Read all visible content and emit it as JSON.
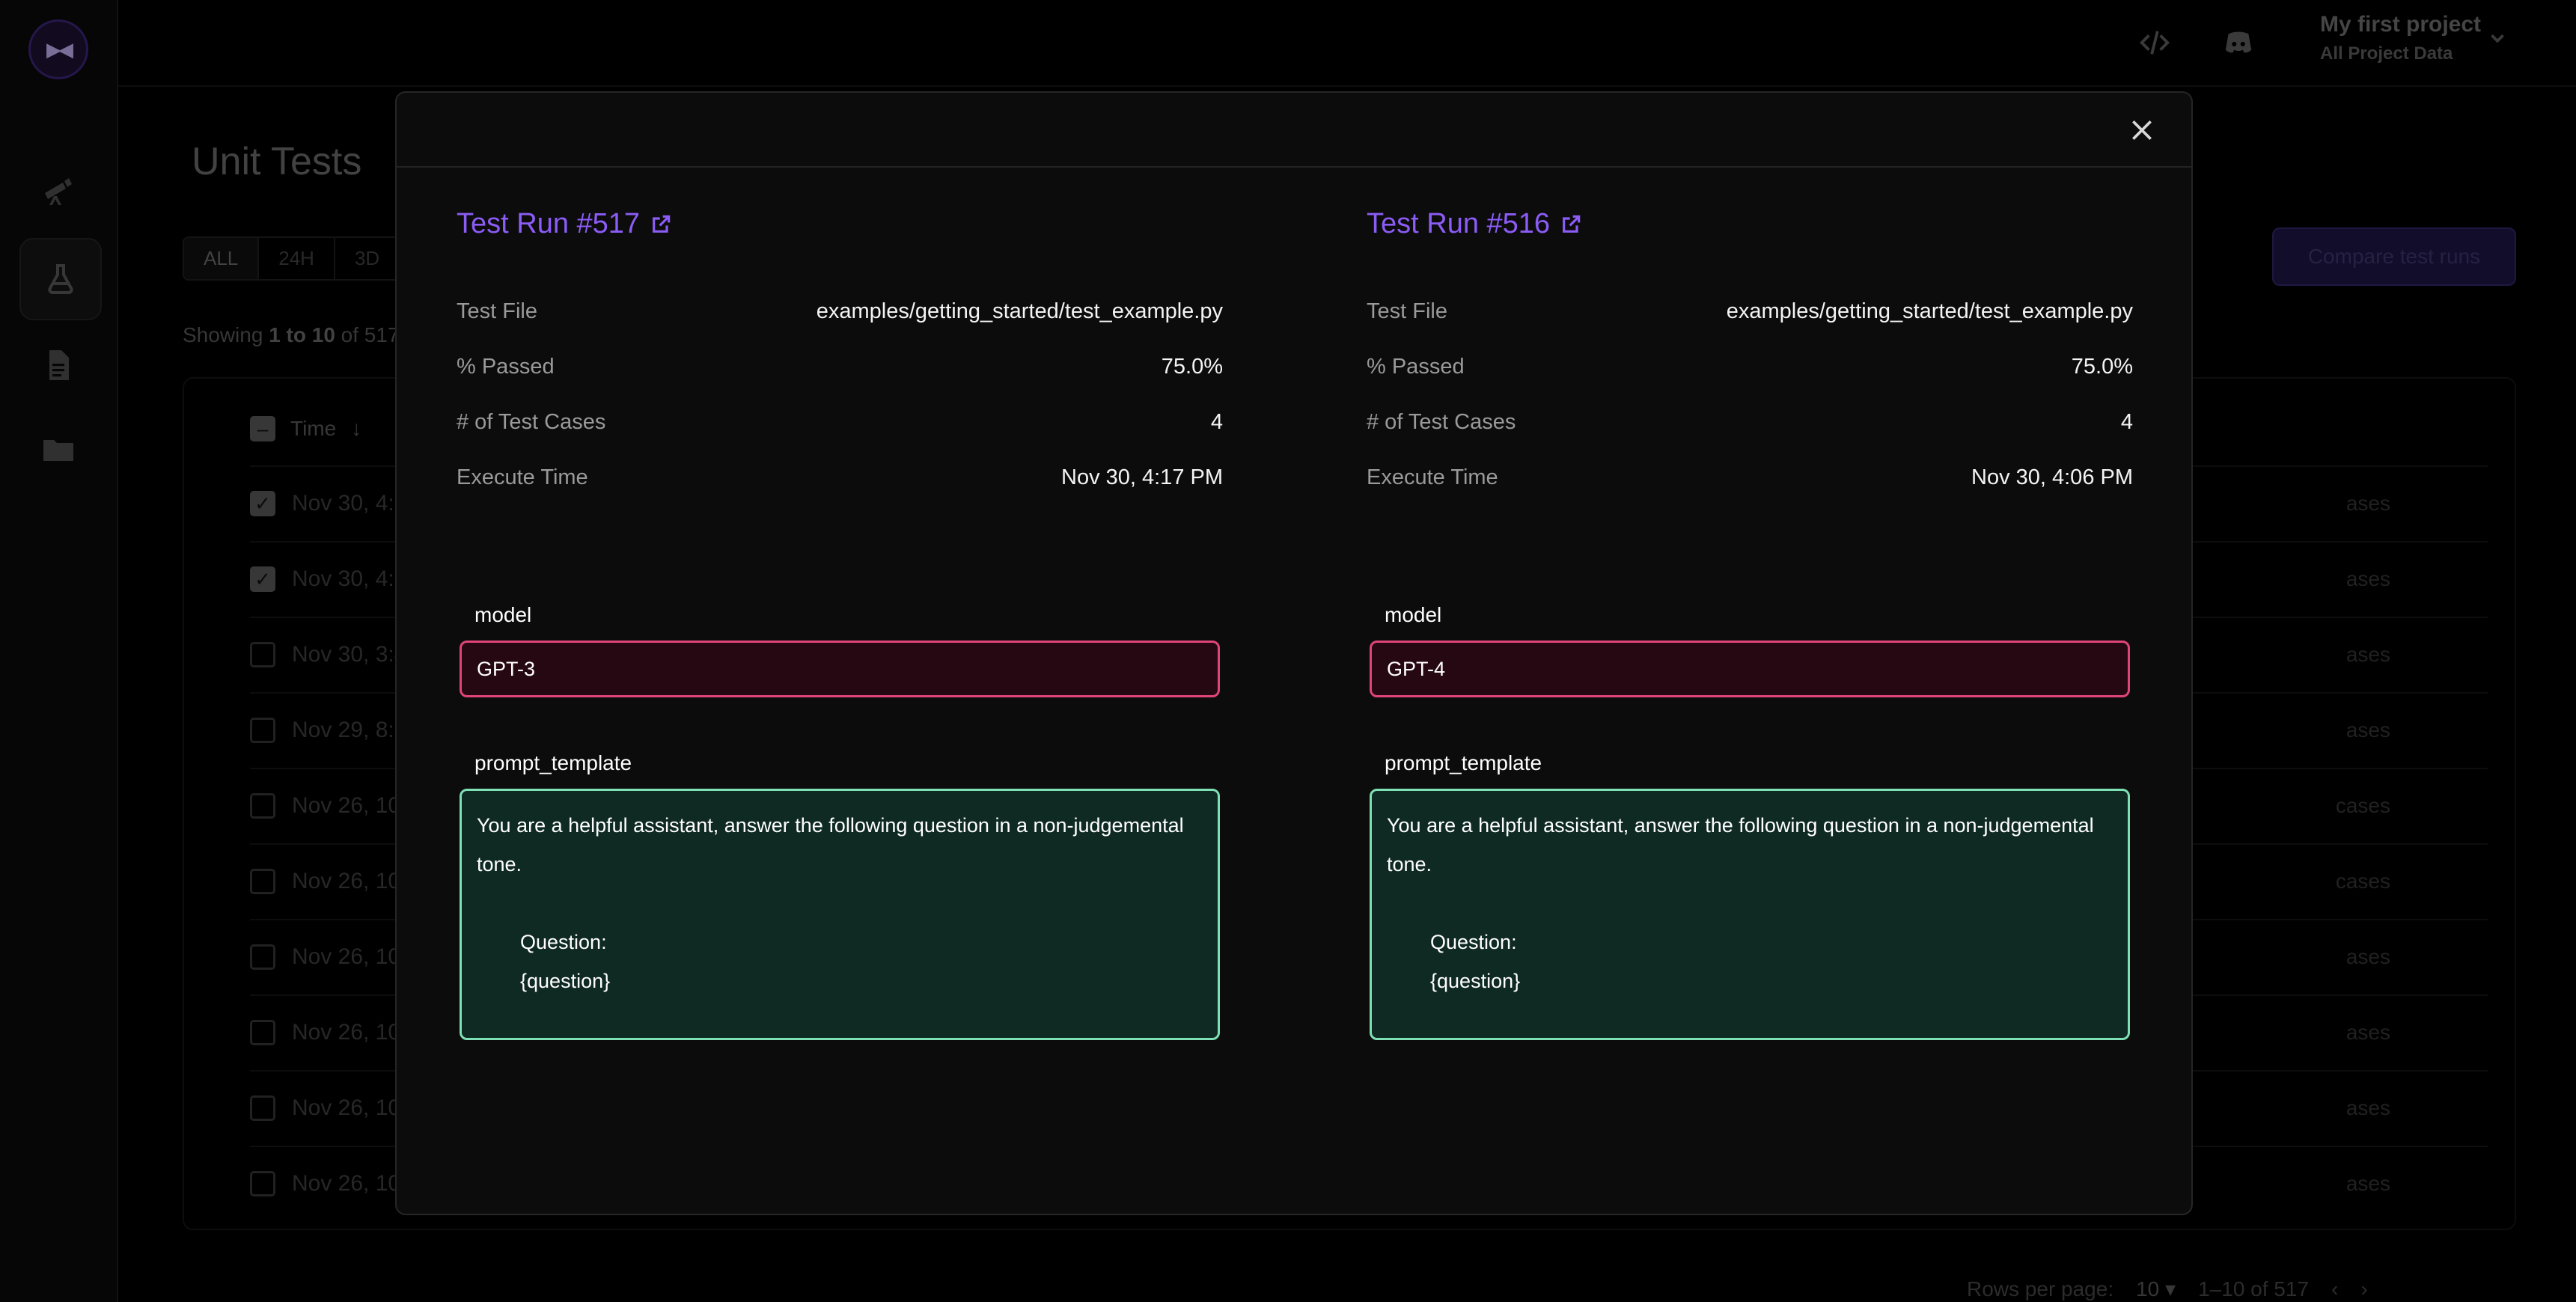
{
  "app": {
    "page_title": "Unit Tests",
    "project_name": "My first project",
    "project_scope": "All Project Data",
    "filters": [
      "ALL",
      "24H",
      "3D"
    ],
    "compare_button": "Compare test runs",
    "showing_prefix": "Showing",
    "showing_range": "1 to 10",
    "showing_suffix": "of 517",
    "table_header_time": "Time",
    "rows": [
      {
        "time": "Nov 30, 4:1",
        "checked": true,
        "cases": "ases"
      },
      {
        "time": "Nov 30, 4:0",
        "checked": true,
        "cases": "ases"
      },
      {
        "time": "Nov 30, 3:4",
        "checked": false,
        "cases": "ases"
      },
      {
        "time": "Nov 29, 8:0",
        "checked": false,
        "cases": "ases"
      },
      {
        "time": "Nov 26, 10",
        "checked": false,
        "cases": "cases"
      },
      {
        "time": "Nov 26, 10",
        "checked": false,
        "cases": "cases"
      },
      {
        "time": "Nov 26, 10",
        "checked": false,
        "cases": "ases"
      },
      {
        "time": "Nov 26, 10",
        "checked": false,
        "cases": "ases"
      },
      {
        "time": "Nov 26, 10",
        "checked": false,
        "cases": "ases"
      },
      {
        "time": "Nov 26, 10",
        "checked": false,
        "cases": "ases"
      }
    ],
    "rows_per_page_label": "Rows per page:",
    "rows_per_page_value": "10",
    "pagination_range": "1–10 of 517"
  },
  "modal": {
    "runs": [
      {
        "title": "Test Run #517",
        "meta": [
          {
            "label": "Test File",
            "value": "examples/getting_started/test_example.py"
          },
          {
            "label": "% Passed",
            "value": "75.0%"
          },
          {
            "label": "# of Test Cases",
            "value": "4"
          },
          {
            "label": "Execute Time",
            "value": "Nov 30, 4:17 PM"
          }
        ],
        "model_label": "model",
        "model_value": "GPT-3",
        "prompt_label": "prompt_template",
        "prompt_line1": "You are a helpful assistant, answer the following question in a non-judgemental",
        "prompt_line2": "tone.",
        "prompt_line3": "Question:",
        "prompt_line4": "{question}"
      },
      {
        "title": "Test Run #516",
        "meta": [
          {
            "label": "Test File",
            "value": "examples/getting_started/test_example.py"
          },
          {
            "label": "% Passed",
            "value": "75.0%"
          },
          {
            "label": "# of Test Cases",
            "value": "4"
          },
          {
            "label": "Execute Time",
            "value": "Nov 30, 4:06 PM"
          }
        ],
        "model_label": "model",
        "model_value": "GPT-4",
        "prompt_label": "prompt_template",
        "prompt_line1": "You are a helpful assistant, answer the following question in a non-judgemental",
        "prompt_line2": "tone.",
        "prompt_line3": "Question:",
        "prompt_line4": "{question}"
      }
    ],
    "colors": {
      "link": "#8b5cf6",
      "diff_border": "#e0457a",
      "same_border": "#7ee0b4"
    }
  }
}
